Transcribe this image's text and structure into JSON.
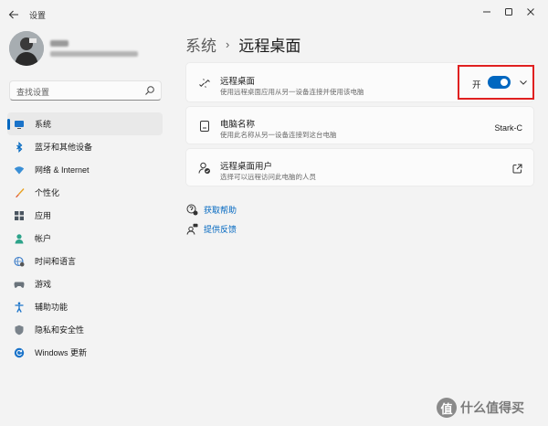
{
  "app": {
    "title": "设置"
  },
  "search": {
    "placeholder": "查找设置"
  },
  "sidebar": {
    "items": [
      {
        "label": "系统",
        "icon": "monitor-icon",
        "active": true
      },
      {
        "label": "蓝牙和其他设备",
        "icon": "bluetooth-icon"
      },
      {
        "label": "网络 & Internet",
        "icon": "wifi-icon"
      },
      {
        "label": "个性化",
        "icon": "brush-icon"
      },
      {
        "label": "应用",
        "icon": "apps-icon"
      },
      {
        "label": "帐户",
        "icon": "person-icon"
      },
      {
        "label": "时间和语言",
        "icon": "globe-clock-icon"
      },
      {
        "label": "游戏",
        "icon": "gamepad-icon"
      },
      {
        "label": "辅助功能",
        "icon": "accessibility-icon"
      },
      {
        "label": "隐私和安全性",
        "icon": "shield-icon"
      },
      {
        "label": "Windows 更新",
        "icon": "update-icon"
      }
    ]
  },
  "header": {
    "parent": "系统",
    "separator": "›",
    "current": "远程桌面"
  },
  "cards": {
    "remote_desktop": {
      "title": "远程桌面",
      "subtitle": "使用远程桌面应用从另一设备连接并使用该电脑",
      "toggle_label": "开",
      "toggle_on": true
    },
    "pc_name": {
      "title": "电脑名称",
      "subtitle": "使用此名称从另一设备连接到这台电脑",
      "value": "Stark-C"
    },
    "users": {
      "title": "远程桌面用户",
      "subtitle": "选择可以远程访问此电脑的人员"
    }
  },
  "links": {
    "help": "获取帮助",
    "feedback": "提供反馈"
  },
  "watermark": {
    "badge": "值",
    "text": "什么值得买"
  },
  "colors": {
    "accent": "#0067c0",
    "highlight_box": "#e02020",
    "background": "#f3f3f3",
    "card": "#fbfbfb"
  }
}
